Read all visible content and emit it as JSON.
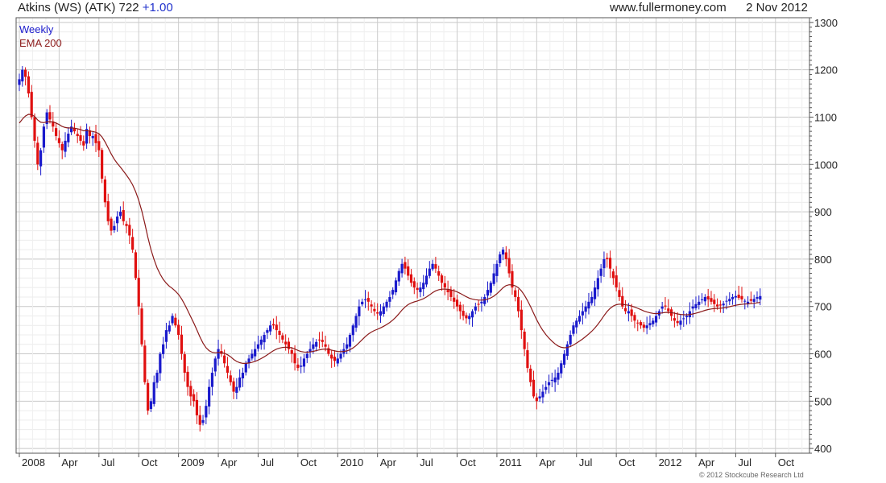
{
  "header": {
    "title": "Atkins (WS) (ATK) 722",
    "change": "+1.00",
    "site": "www.fullermoney.com",
    "date": "2 Nov 2012"
  },
  "copyright": "© 2012 Stockcube Research Ltd",
  "colors": {
    "up": "#1a1acc",
    "down": "#e01010",
    "ema": "#8b1a1a",
    "grid": "#d8d8d8",
    "frame": "#555555"
  },
  "chart_data": {
    "type": "candlestick",
    "ylim": [
      390,
      1310
    ],
    "yticks": [
      400,
      500,
      600,
      700,
      800,
      900,
      1000,
      1100,
      1200,
      1300
    ],
    "xlim": [
      0,
      256
    ],
    "xtick_labels": [
      {
        "i": 0,
        "label": "2008"
      },
      {
        "i": 13,
        "label": "Apr"
      },
      {
        "i": 26,
        "label": "Jul"
      },
      {
        "i": 39,
        "label": "Oct"
      },
      {
        "i": 52,
        "label": "2009"
      },
      {
        "i": 65,
        "label": "Apr"
      },
      {
        "i": 78,
        "label": "Jul"
      },
      {
        "i": 91,
        "label": "Oct"
      },
      {
        "i": 104,
        "label": "2010"
      },
      {
        "i": 117,
        "label": "Apr"
      },
      {
        "i": 130,
        "label": "Jul"
      },
      {
        "i": 143,
        "label": "Oct"
      },
      {
        "i": 156,
        "label": "2011"
      },
      {
        "i": 169,
        "label": "Apr"
      },
      {
        "i": 182,
        "label": "Jul"
      },
      {
        "i": 195,
        "label": "Oct"
      },
      {
        "i": 208,
        "label": "2012"
      },
      {
        "i": 221,
        "label": "Apr"
      },
      {
        "i": 234,
        "label": "Jul"
      },
      {
        "i": 247,
        "label": "Oct"
      }
    ],
    "legend": [
      "Weekly",
      "EMA 200"
    ],
    "legend_position": "top-left",
    "grid": true,
    "close": [
      1180,
      1200,
      1185,
      1150,
      1100,
      1050,
      1000,
      1030,
      1080,
      1110,
      1095,
      1080,
      1060,
      1045,
      1030,
      1050,
      1065,
      1080,
      1070,
      1060,
      1050,
      1040,
      1075,
      1060,
      1060,
      1045,
      1030,
      970,
      920,
      880,
      860,
      870,
      890,
      900,
      880,
      870,
      850,
      820,
      760,
      700,
      620,
      540,
      480,
      500,
      540,
      560,
      600,
      620,
      650,
      660,
      680,
      660,
      640,
      600,
      560,
      530,
      510,
      500,
      470,
      450,
      460,
      490,
      530,
      560,
      590,
      610,
      600,
      580,
      560,
      540,
      520,
      530,
      550,
      560,
      580,
      590,
      600,
      610,
      620,
      630,
      640,
      650,
      660,
      660,
      650,
      640,
      630,
      620,
      610,
      600,
      580,
      570,
      575,
      590,
      600,
      610,
      620,
      625,
      630,
      625,
      615,
      600,
      590,
      585,
      590,
      600,
      610,
      620,
      640,
      660,
      680,
      700,
      710,
      715,
      710,
      700,
      690,
      685,
      690,
      700,
      710,
      720,
      735,
      755,
      775,
      790,
      780,
      765,
      750,
      740,
      735,
      740,
      750,
      765,
      780,
      790,
      780,
      765,
      750,
      740,
      730,
      720,
      710,
      700,
      690,
      680,
      675,
      680,
      690,
      700,
      705,
      710,
      720,
      735,
      750,
      770,
      790,
      810,
      820,
      800,
      770,
      740,
      720,
      690,
      650,
      610,
      570,
      540,
      510,
      500,
      510,
      520,
      530,
      540,
      545,
      550,
      560,
      580,
      600,
      620,
      640,
      660,
      670,
      680,
      690,
      700,
      710,
      720,
      740,
      760,
      780,
      800,
      800,
      780,
      760,
      740,
      720,
      700,
      690,
      690,
      680,
      670,
      665,
      660,
      655,
      660,
      665,
      670,
      680,
      690,
      700,
      700,
      690,
      680,
      670,
      665,
      670,
      675,
      680,
      690,
      700,
      705,
      710,
      715,
      720,
      715,
      710,
      705,
      700,
      702,
      706,
      712,
      716,
      720,
      722,
      718,
      715,
      712,
      710,
      712,
      716,
      720,
      722
    ]
  }
}
